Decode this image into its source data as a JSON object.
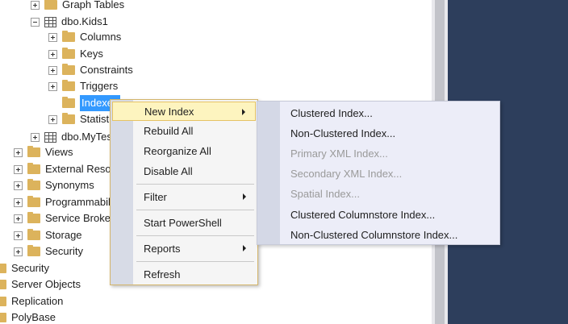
{
  "tree": {
    "items": [
      {
        "label": "Graph Tables",
        "expander": "plus",
        "icon": "folder"
      },
      {
        "label": "dbo.Kids1",
        "expander": "minus",
        "icon": "table"
      },
      {
        "label": "Columns",
        "expander": "plus",
        "icon": "folder"
      },
      {
        "label": "Keys",
        "expander": "plus",
        "icon": "folder"
      },
      {
        "label": "Constraints",
        "expander": "plus",
        "icon": "folder"
      },
      {
        "label": "Triggers",
        "expander": "plus",
        "icon": "folder"
      },
      {
        "label": "Indexes",
        "expander": "none",
        "icon": "folder",
        "selected": true
      },
      {
        "label": "Statistics",
        "expander": "plus",
        "icon": "folder"
      },
      {
        "label": "dbo.MyTest",
        "expander": "plus",
        "icon": "table"
      },
      {
        "label": "Views",
        "expander": "plus",
        "icon": "folder"
      },
      {
        "label": "External Resources",
        "expander": "plus",
        "icon": "folder"
      },
      {
        "label": "Synonyms",
        "expander": "plus",
        "icon": "folder"
      },
      {
        "label": "Programmability",
        "expander": "plus",
        "icon": "folder"
      },
      {
        "label": "Service Broker",
        "expander": "plus",
        "icon": "folder"
      },
      {
        "label": "Storage",
        "expander": "plus",
        "icon": "folder"
      },
      {
        "label": "Security",
        "expander": "plus",
        "icon": "folder"
      },
      {
        "label": "Security",
        "expander": "none",
        "icon": "folder"
      },
      {
        "label": "Server Objects",
        "expander": "none",
        "icon": "folder"
      },
      {
        "label": "Replication",
        "expander": "none",
        "icon": "folder"
      },
      {
        "label": "PolyBase",
        "expander": "none",
        "icon": "folder"
      }
    ]
  },
  "context_menu": {
    "items": [
      {
        "label": "New Index",
        "submenu": true,
        "highlighted": true
      },
      {
        "label": "Rebuild All"
      },
      {
        "label": "Reorganize All"
      },
      {
        "label": "Disable All"
      },
      {
        "label": "Filter",
        "submenu": true
      },
      {
        "label": "Start PowerShell"
      },
      {
        "label": "Reports",
        "submenu": true
      },
      {
        "label": "Refresh"
      }
    ]
  },
  "submenu": {
    "items": [
      {
        "label": "Clustered Index...",
        "enabled": true
      },
      {
        "label": "Non-Clustered Index...",
        "enabled": true
      },
      {
        "label": "Primary XML Index...",
        "enabled": false
      },
      {
        "label": "Secondary XML Index...",
        "enabled": false
      },
      {
        "label": "Spatial Index...",
        "enabled": false
      },
      {
        "label": "Clustered Columnstore Index...",
        "enabled": true
      },
      {
        "label": "Non-Clustered Columnstore Index...",
        "enabled": true
      }
    ]
  },
  "colors": {
    "selection": "#3399ff",
    "menu_hover": "#fdf4bf",
    "menu_border": "#d4b56a",
    "dark_panel": "#2d3e5c",
    "folder": "#dcb35c",
    "disabled_text": "#9a9a9a"
  }
}
